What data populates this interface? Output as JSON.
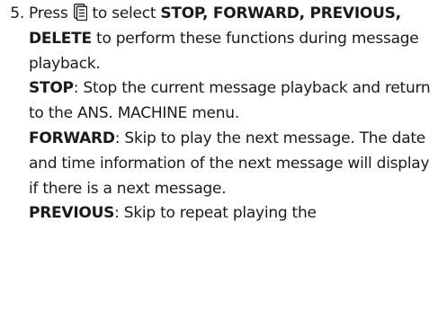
{
  "step": {
    "number": "5.",
    "intro_prefix": "Press",
    "icon": "menu-list-icon",
    "intro_mid": "to select",
    "intro_options": "STOP, FORWARD, PREVIOUS, DELETE",
    "intro_suffix": "to perform these functions during message playback."
  },
  "functions": [
    {
      "name": "STOP",
      "description": ": Stop the current message playback and return to the ANS. MACHINE menu."
    },
    {
      "name": "FORWARD",
      "description": ": Skip to play the next message. The date and time information of the next message will display if there is a next message."
    },
    {
      "name": "PREVIOUS",
      "description": ": Skip to repeat playing the"
    }
  ]
}
